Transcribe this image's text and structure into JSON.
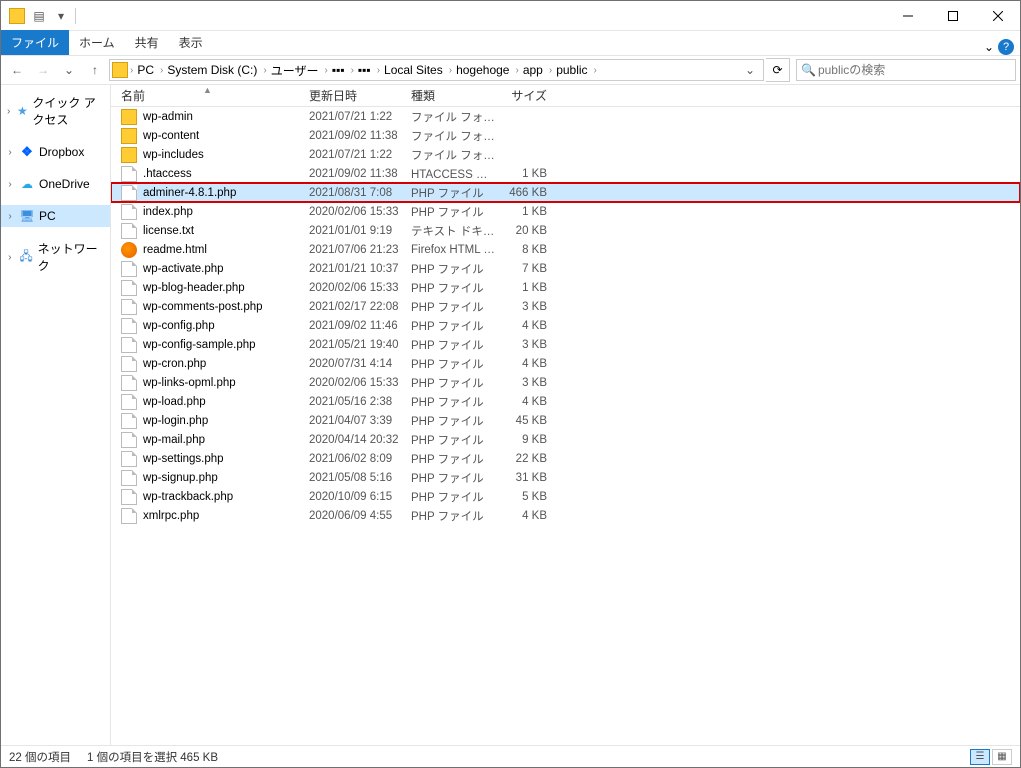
{
  "titlebar": {
    "qat_chevron": "▾"
  },
  "ribbon": {
    "file": "ファイル",
    "home": "ホーム",
    "share": "共有",
    "view": "表示",
    "expand": "⌄"
  },
  "nav": {
    "back": "←",
    "forward": "→",
    "recent": "⌄",
    "up": "↑",
    "dropdown": "⌄",
    "refresh": "⟳"
  },
  "breadcrumb": [
    {
      "label": "PC"
    },
    {
      "label": "System Disk (C:)"
    },
    {
      "label": "ユーザー"
    },
    {
      "label": "▪▪▪"
    },
    {
      "label": "▪▪▪"
    },
    {
      "label": "Local Sites"
    },
    {
      "label": "hogehoge"
    },
    {
      "label": "app"
    },
    {
      "label": "public"
    }
  ],
  "search": {
    "placeholder": "publicの検索"
  },
  "sidebar": {
    "quick_access": "クイック アクセス",
    "dropbox": "Dropbox",
    "onedrive": "OneDrive",
    "pc": "PC",
    "network": "ネットワーク"
  },
  "columns": {
    "name": "名前",
    "date": "更新日時",
    "type": "種類",
    "size": "サイズ"
  },
  "files": [
    {
      "icon": "folder",
      "name": "wp-admin",
      "date": "2021/07/21 1:22",
      "type": "ファイル フォルダー",
      "size": ""
    },
    {
      "icon": "folder",
      "name": "wp-content",
      "date": "2021/09/02 11:38",
      "type": "ファイル フォルダー",
      "size": ""
    },
    {
      "icon": "folder",
      "name": "wp-includes",
      "date": "2021/07/21 1:22",
      "type": "ファイル フォルダー",
      "size": ""
    },
    {
      "icon": "file",
      "name": ".htaccess",
      "date": "2021/09/02 11:38",
      "type": "HTACCESS ファイル",
      "size": "1 KB"
    },
    {
      "icon": "file",
      "name": "adminer-4.8.1.php",
      "date": "2021/08/31 7:08",
      "type": "PHP ファイル",
      "size": "466 KB",
      "highlight": true
    },
    {
      "icon": "file",
      "name": "index.php",
      "date": "2020/02/06 15:33",
      "type": "PHP ファイル",
      "size": "1 KB"
    },
    {
      "icon": "file",
      "name": "license.txt",
      "date": "2021/01/01 9:19",
      "type": "テキスト ドキュメント",
      "size": "20 KB"
    },
    {
      "icon": "firefox",
      "name": "readme.html",
      "date": "2021/07/06 21:23",
      "type": "Firefox HTML Docum...",
      "size": "8 KB"
    },
    {
      "icon": "file",
      "name": "wp-activate.php",
      "date": "2021/01/21 10:37",
      "type": "PHP ファイル",
      "size": "7 KB"
    },
    {
      "icon": "file",
      "name": "wp-blog-header.php",
      "date": "2020/02/06 15:33",
      "type": "PHP ファイル",
      "size": "1 KB"
    },
    {
      "icon": "file",
      "name": "wp-comments-post.php",
      "date": "2021/02/17 22:08",
      "type": "PHP ファイル",
      "size": "3 KB"
    },
    {
      "icon": "file",
      "name": "wp-config.php",
      "date": "2021/09/02 11:46",
      "type": "PHP ファイル",
      "size": "4 KB"
    },
    {
      "icon": "file",
      "name": "wp-config-sample.php",
      "date": "2021/05/21 19:40",
      "type": "PHP ファイル",
      "size": "3 KB"
    },
    {
      "icon": "file",
      "name": "wp-cron.php",
      "date": "2020/07/31 4:14",
      "type": "PHP ファイル",
      "size": "4 KB"
    },
    {
      "icon": "file",
      "name": "wp-links-opml.php",
      "date": "2020/02/06 15:33",
      "type": "PHP ファイル",
      "size": "3 KB"
    },
    {
      "icon": "file",
      "name": "wp-load.php",
      "date": "2021/05/16 2:38",
      "type": "PHP ファイル",
      "size": "4 KB"
    },
    {
      "icon": "file",
      "name": "wp-login.php",
      "date": "2021/04/07 3:39",
      "type": "PHP ファイル",
      "size": "45 KB"
    },
    {
      "icon": "file",
      "name": "wp-mail.php",
      "date": "2020/04/14 20:32",
      "type": "PHP ファイル",
      "size": "9 KB"
    },
    {
      "icon": "file",
      "name": "wp-settings.php",
      "date": "2021/06/02 8:09",
      "type": "PHP ファイル",
      "size": "22 KB"
    },
    {
      "icon": "file",
      "name": "wp-signup.php",
      "date": "2021/05/08 5:16",
      "type": "PHP ファイル",
      "size": "31 KB"
    },
    {
      "icon": "file",
      "name": "wp-trackback.php",
      "date": "2020/10/09 6:15",
      "type": "PHP ファイル",
      "size": "5 KB"
    },
    {
      "icon": "file",
      "name": "xmlrpc.php",
      "date": "2020/06/09 4:55",
      "type": "PHP ファイル",
      "size": "4 KB"
    }
  ],
  "status": {
    "count": "22 個の項目",
    "selection": "1 個の項目を選択 465 KB"
  }
}
